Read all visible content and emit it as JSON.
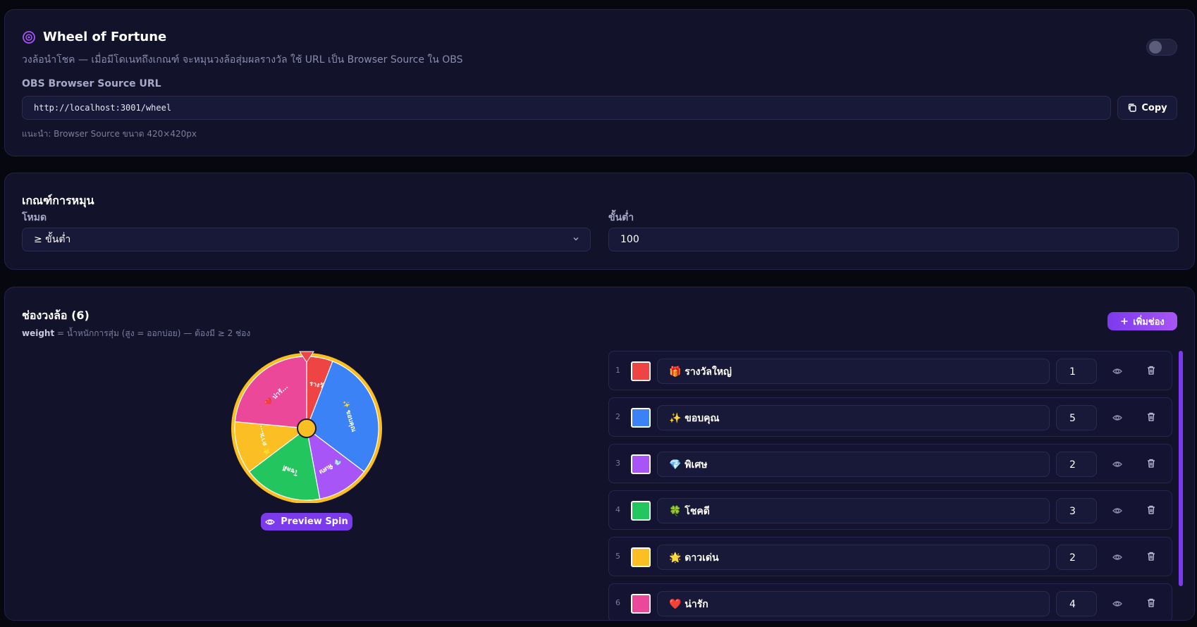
{
  "source": {
    "title": "Wheel of Fortune",
    "subtitle": "วงล้อนำโชค — เมื่อมีโดเนทถึงเกณฑ์ จะหมุนวงล้อสุ่มผลรางวัล ใช้ URL เป็น Browser Source ใน OBS",
    "url_label": "OBS Browser Source URL",
    "url": "http://localhost:3001/wheel",
    "copy_label": "Copy",
    "hint": "แนะนำ: Browser Source ขนาด 420×420px",
    "enabled": false
  },
  "criteria": {
    "title": "เกณฑ์การหมุน",
    "mode_label": "โหมด",
    "mode_value": "≥ ขั้นต่ำ",
    "min_label": "ขั้นต่ำ",
    "min_value": "100"
  },
  "slots": {
    "title": "ช่องวงล้อ (6)",
    "note_bold": "weight",
    "note_rest": " = น้ำหนักการสุ่ม (สูง = ออกบ่อย) — ต้องมี ≥ 2 ช่อง",
    "add_label": "เพิ่มช่อง",
    "preview_label": "Preview Spin",
    "items": [
      {
        "index": "1",
        "emoji": "🎁",
        "name": "รางวัลใหญ่",
        "short": "🎁 รางวั...",
        "weight": 1,
        "color": "#ef4444"
      },
      {
        "index": "2",
        "emoji": "✨",
        "name": "ขอบคุณ",
        "short": "✨ ขอบคุณ",
        "weight": 5,
        "color": "#3b82f6"
      },
      {
        "index": "3",
        "emoji": "💎",
        "name": "พิเศษ",
        "short": "💎 พิเศษ",
        "weight": 2,
        "color": "#a855f7"
      },
      {
        "index": "4",
        "emoji": "🍀",
        "name": "โชคดี",
        "short": "โชคดี",
        "weight": 3,
        "color": "#22c55e"
      },
      {
        "index": "5",
        "emoji": "🌟",
        "name": "ดาวเด่น",
        "short": "🌟 ดาวเ...",
        "weight": 2,
        "color": "#fbbf24"
      },
      {
        "index": "6",
        "emoji": "❤️",
        "name": "น่ารัก",
        "short": "❤️ น่ารั...",
        "weight": 4,
        "color": "#ec4899"
      }
    ]
  },
  "colors": {
    "accent": "#7c3aed",
    "wheel_rim": "#fbbf24"
  }
}
